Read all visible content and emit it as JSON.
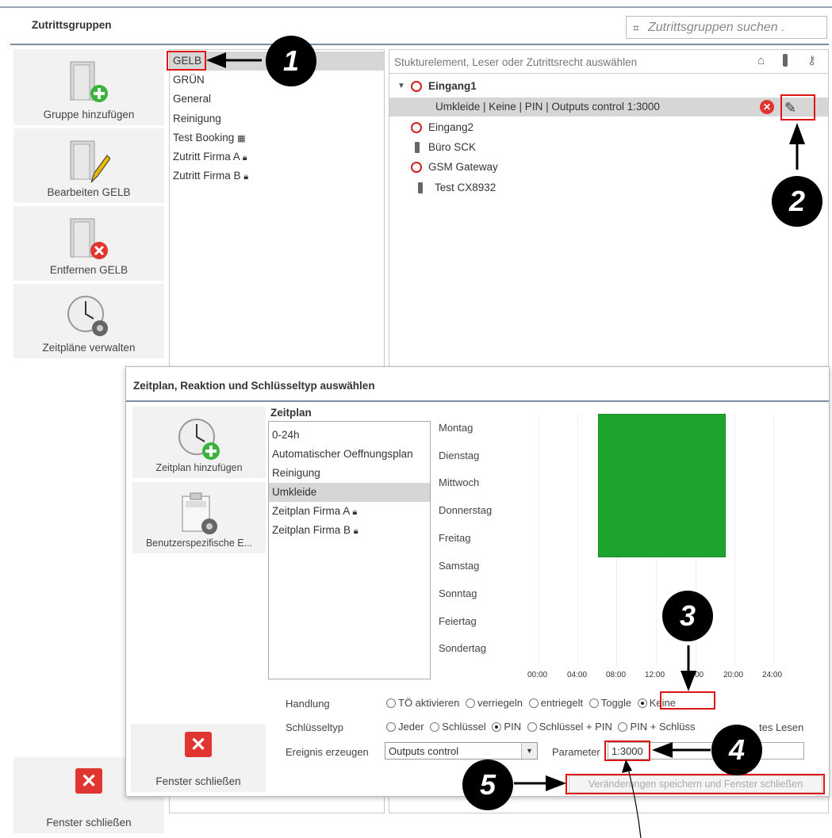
{
  "header": {
    "title": "Zutrittsgruppen",
    "search_placeholder": "Zutrittsgruppen suchen ."
  },
  "left_tiles": [
    {
      "label": "Gruppe hinzufügen",
      "icon": "door-add-icon"
    },
    {
      "label": "Bearbeiten GELB",
      "icon": "door-edit-icon"
    },
    {
      "label": "Entfernen GELB",
      "icon": "door-remove-icon"
    },
    {
      "label": "Zeitpläne verwalten",
      "icon": "clock-gear-icon"
    }
  ],
  "groups": [
    {
      "label": "GELB",
      "selected": true
    },
    {
      "label": "GRÜN"
    },
    {
      "label": "General"
    },
    {
      "label": "Reinigung"
    },
    {
      "label": "Test Booking",
      "icon": "grid-icon"
    },
    {
      "label": "Zutritt Firma A",
      "icon": "lock-icon"
    },
    {
      "label": "Zutritt Firma B",
      "icon": "lock-icon"
    }
  ],
  "structure": {
    "placeholder": "Stukturelement, Leser oder Zutrittsrecht auswählen",
    "toolbar_icons": [
      "building-icon",
      "reader-icon",
      "key-icon"
    ],
    "rows": [
      {
        "label": "Eingang1",
        "type": "door",
        "expanded": true,
        "bold": true
      },
      {
        "label": "Umkleide | Keine | PIN | Outputs control 1:3000",
        "type": "right",
        "selected": true
      },
      {
        "label": "Eingang2",
        "type": "door"
      },
      {
        "label": "Büro SCK",
        "type": "reader"
      },
      {
        "label": "GSM Gateway",
        "type": "door"
      },
      {
        "label": "Test CX8932",
        "type": "reader"
      }
    ]
  },
  "dialog": {
    "title": "Zeitplan, Reaktion und Schlüsseltyp auswählen",
    "tiles": [
      {
        "label": "Zeitplan hinzufügen",
        "icon": "clock-add-icon"
      },
      {
        "label": "Benutzerspezifische E...",
        "icon": "event-gear-icon"
      }
    ],
    "schedule_heading": "Zeitplan",
    "schedules": [
      {
        "label": "0-24h"
      },
      {
        "label": "Automatischer Oeffnungsplan"
      },
      {
        "label": "Reinigung"
      },
      {
        "label": "Umkleide",
        "selected": true
      },
      {
        "label": "Zeitplan Firma A",
        "icon": "lock-icon"
      },
      {
        "label": "Zeitplan Firma B",
        "icon": "lock-icon"
      }
    ],
    "days": [
      "Montag",
      "Dienstag",
      "Mittwoch",
      "Donnerstag",
      "Freitag",
      "Samstag",
      "Sonntag",
      "Feiertag",
      "Sondertag"
    ],
    "ticks": [
      "00:00",
      "04:00",
      "08:00",
      "12:00",
      "16:00",
      "20:00",
      "24:00"
    ],
    "ticks_visible": [
      "00:00",
      "04:00",
      "08:00",
      "12:00",
      "00",
      "20:00",
      "24:00"
    ],
    "handlung_label": "Handlung",
    "handlung_options": [
      {
        "label": "TÖ aktivieren"
      },
      {
        "label": "verriegeln"
      },
      {
        "label": "entriegelt"
      },
      {
        "label": "Toggle"
      },
      {
        "label": "Keine",
        "checked": true
      }
    ],
    "schluessel_label": "Schlüsseltyp",
    "schluessel_options": [
      {
        "label": "Jeder"
      },
      {
        "label": "Schlüssel"
      },
      {
        "label": "PIN",
        "checked": true
      },
      {
        "label": "Schlüssel + PIN"
      },
      {
        "label": "PIN + Schlüss"
      }
    ],
    "schluessel_tail": "tes Lesen",
    "ereignis_label": "Ereignis erzeugen",
    "ereignis_value": "Outputs control",
    "parameter_label": "Parameter",
    "parameter_value": "1:3000",
    "save_button": "Veränderungen speichern und Fenster schließen",
    "close_label": "Fenster schließen"
  },
  "bottom_close_label": "Fenster schließen",
  "callouts": [
    "1",
    "2",
    "3",
    "4",
    "5"
  ],
  "colors": {
    "schedule_bar": "#1ea42c",
    "highlight_red": "#e01515",
    "selection": "#d6d6d6"
  }
}
